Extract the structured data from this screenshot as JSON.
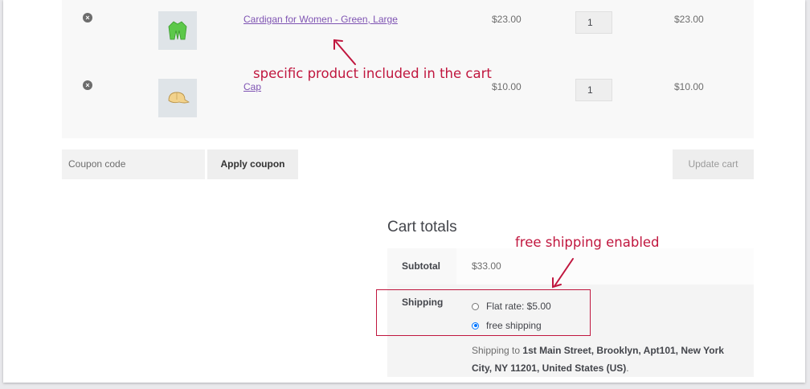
{
  "cart": {
    "items": [
      {
        "remove": "×",
        "name": "Cardigan for Women - Green, Large",
        "price": "$23.00",
        "qty": "1",
        "subtotal": "$23.00",
        "thumb": "cardigan-thumbnail"
      },
      {
        "remove": "×",
        "name": "Cap",
        "price": "$10.00",
        "qty": "1",
        "subtotal": "$10.00",
        "thumb": "cap-thumbnail"
      }
    ]
  },
  "actions": {
    "coupon_placeholder": "Coupon code",
    "apply_label": "Apply coupon",
    "update_label": "Update cart"
  },
  "totals": {
    "title": "Cart totals",
    "subtotal_label": "Subtotal",
    "subtotal_value": "$33.00",
    "shipping_label": "Shipping",
    "options": [
      {
        "label": "Flat rate: $5.00",
        "selected": false
      },
      {
        "label": "free shipping",
        "selected": true
      }
    ],
    "ship_to_prefix": "Shipping to ",
    "ship_to_address": "1st Main Street, Brooklyn, Apt101, New York City, NY 11201, United States (US)",
    "ship_to_suffix": "."
  },
  "annotations": {
    "product": "specific product included in the cart",
    "shipping": "free shipping enabled",
    "color": "#c0163e"
  },
  "colors": {
    "link": "#7f54b3",
    "radio_selected": "#0075ff"
  }
}
